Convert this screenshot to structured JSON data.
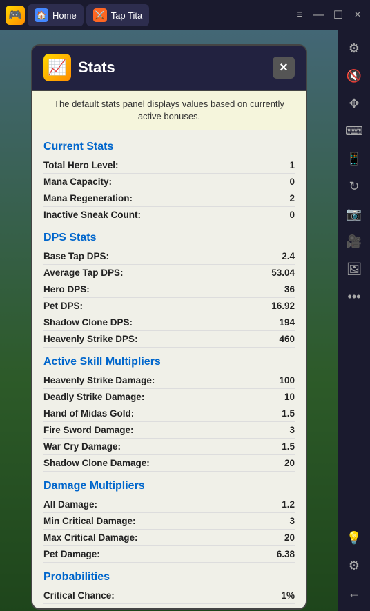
{
  "taskbar": {
    "logo": "🎮",
    "tabs": [
      {
        "id": "home",
        "label": "Home",
        "icon": "🏠",
        "color": "#4488ff"
      },
      {
        "id": "game",
        "label": "Tap Tita",
        "icon": "⚔️",
        "color": "#ff6622"
      }
    ],
    "controls": [
      "≡",
      "—",
      "☐",
      "×"
    ]
  },
  "sidebar": {
    "icons": [
      {
        "id": "settings",
        "symbol": "⚙",
        "active": false
      },
      {
        "id": "sound",
        "symbol": "🔇",
        "active": false
      },
      {
        "id": "move",
        "symbol": "✥",
        "active": false
      },
      {
        "id": "keyboard",
        "symbol": "⌨",
        "active": false
      },
      {
        "id": "phone",
        "symbol": "📱",
        "active": false
      },
      {
        "id": "rotate",
        "symbol": "↻",
        "active": false
      },
      {
        "id": "camera",
        "symbol": "📷",
        "active": false
      },
      {
        "id": "video",
        "symbol": "🎥",
        "active": false
      },
      {
        "id": "gallery",
        "symbol": "🖼",
        "active": false
      },
      {
        "id": "dots",
        "symbol": "…",
        "active": false
      },
      {
        "id": "bulb",
        "symbol": "💡",
        "active": false,
        "yellow": true
      },
      {
        "id": "gear",
        "symbol": "⚙",
        "active": false
      },
      {
        "id": "back",
        "symbol": "←",
        "active": false
      }
    ]
  },
  "modal": {
    "icon": "📈",
    "title": "Stats",
    "close_label": "×",
    "subtitle": "The default stats panel displays values based on currently active bonuses.",
    "sections": [
      {
        "id": "current-stats",
        "header": "Current Stats",
        "rows": [
          {
            "label": "Total Hero Level:",
            "value": "1"
          },
          {
            "label": "Mana Capacity:",
            "value": "0"
          },
          {
            "label": "Mana Regeneration:",
            "value": "2"
          },
          {
            "label": "Inactive Sneak Count:",
            "value": "0"
          }
        ]
      },
      {
        "id": "dps-stats",
        "header": "DPS Stats",
        "rows": [
          {
            "label": "Base Tap DPS:",
            "value": "2.4"
          },
          {
            "label": "Average Tap DPS:",
            "value": "53.04"
          },
          {
            "label": "Hero DPS:",
            "value": "36"
          },
          {
            "label": "Pet DPS:",
            "value": "16.92"
          },
          {
            "label": "Shadow Clone DPS:",
            "value": "194"
          },
          {
            "label": "Heavenly Strike DPS:",
            "value": "460"
          }
        ]
      },
      {
        "id": "active-skill-multipliers",
        "header": "Active Skill Multipliers",
        "rows": [
          {
            "label": "Heavenly Strike Damage:",
            "value": "100"
          },
          {
            "label": "Deadly Strike Damage:",
            "value": "10"
          },
          {
            "label": "Hand of Midas Gold:",
            "value": "1.5"
          },
          {
            "label": "Fire Sword Damage:",
            "value": "3"
          },
          {
            "label": "War Cry Damage:",
            "value": "1.5"
          },
          {
            "label": "Shadow Clone Damage:",
            "value": "20"
          }
        ]
      },
      {
        "id": "damage-multipliers",
        "header": "Damage Multipliers",
        "rows": [
          {
            "label": "All Damage:",
            "value": "1.2"
          },
          {
            "label": "Min Critical Damage:",
            "value": "3"
          },
          {
            "label": "Max Critical Damage:",
            "value": "20"
          },
          {
            "label": "Pet Damage:",
            "value": "6.38"
          }
        ]
      },
      {
        "id": "probabilities",
        "header": "Probabilities",
        "rows": [
          {
            "label": "Critical Chance:",
            "value": "1%"
          }
        ]
      }
    ]
  }
}
